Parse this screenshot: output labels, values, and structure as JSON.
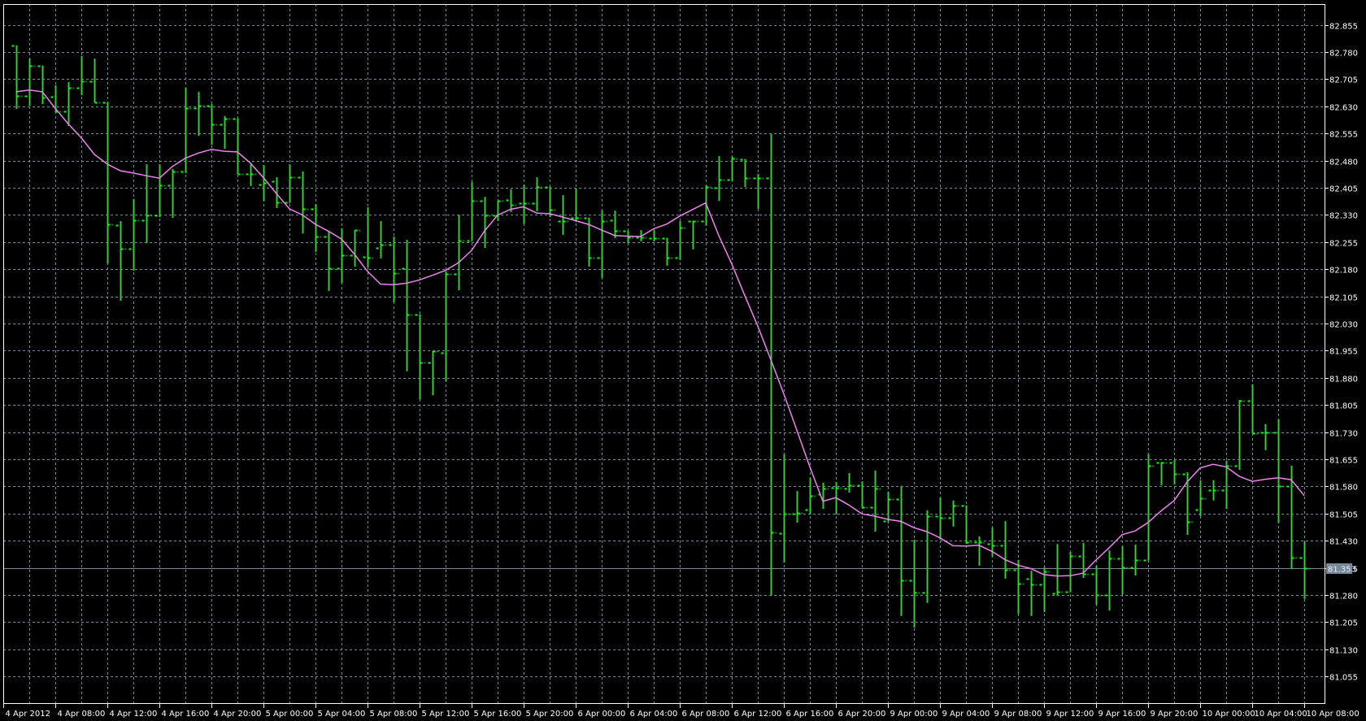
{
  "chart_data": {
    "type": "ohlc",
    "title": "",
    "colors": {
      "background": "#000000",
      "bars": "#32cd32",
      "ticks": "#00ff00",
      "ma": "#ee82ee",
      "grid": "#778899",
      "frame": "#ffffff",
      "price_line": "#778899",
      "price_label_bg": "#778899"
    },
    "ylim": [
      81.0,
      82.9
    ],
    "y_ticks": [
      "82.855",
      "82.780",
      "82.705",
      "82.630",
      "82.555",
      "82.480",
      "82.405",
      "82.330",
      "82.255",
      "82.180",
      "82.105",
      "82.030",
      "81.955",
      "81.880",
      "81.805",
      "81.730",
      "81.655",
      "81.580",
      "81.505",
      "81.430",
      "81.355",
      "81.280",
      "81.205",
      "81.130",
      "81.055"
    ],
    "x_ticks": [
      "4 Apr 2012",
      "4 Apr 08:00",
      "4 Apr 12:00",
      "4 Apr 16:00",
      "4 Apr 20:00",
      "5 Apr 00:00",
      "5 Apr 04:00",
      "5 Apr 08:00",
      "5 Apr 12:00",
      "5 Apr 16:00",
      "5 Apr 20:00",
      "6 Apr 00:00",
      "6 Apr 04:00",
      "6 Apr 08:00",
      "6 Apr 12:00",
      "6 Apr 16:00",
      "6 Apr 20:00",
      "9 Apr 00:00",
      "9 Apr 04:00",
      "9 Apr 08:00",
      "9 Apr 12:00",
      "9 Apr 16:00",
      "9 Apr 20:00",
      "10 Apr 00:00",
      "10 Apr 04:00",
      "10 Apr 08:00"
    ],
    "current_price": "81.353",
    "ma": {
      "type": "SMA",
      "period": 9,
      "centered": true
    },
    "ohlc": [
      [
        82.798,
        82.798,
        82.623,
        82.659
      ],
      [
        82.659,
        82.762,
        82.632,
        82.742
      ],
      [
        82.742,
        82.742,
        82.636,
        82.654
      ],
      [
        82.657,
        82.688,
        82.614,
        82.616
      ],
      [
        82.616,
        82.697,
        82.576,
        82.681
      ],
      [
        82.681,
        82.769,
        82.661,
        82.699
      ],
      [
        82.699,
        82.762,
        82.641,
        82.641
      ],
      [
        82.641,
        82.641,
        82.196,
        82.304
      ],
      [
        82.302,
        82.313,
        82.093,
        82.237
      ],
      [
        82.237,
        82.374,
        82.176,
        82.315
      ],
      [
        82.315,
        82.47,
        82.252,
        82.329
      ],
      [
        82.329,
        82.47,
        82.324,
        82.412
      ],
      [
        82.412,
        82.457,
        82.322,
        82.45
      ],
      [
        82.45,
        82.681,
        82.446,
        82.625
      ],
      [
        82.625,
        82.67,
        82.549,
        82.632
      ],
      [
        82.632,
        82.636,
        82.524,
        82.58
      ],
      [
        82.58,
        82.603,
        82.513,
        82.596
      ],
      [
        82.596,
        82.596,
        82.443,
        82.443
      ],
      [
        82.443,
        82.47,
        82.41,
        82.443
      ],
      [
        82.414,
        82.468,
        82.369,
        82.419
      ],
      [
        82.423,
        82.434,
        82.349,
        82.365
      ],
      [
        82.365,
        82.47,
        82.365,
        82.434
      ],
      [
        82.434,
        82.45,
        82.279,
        82.347
      ],
      [
        82.347,
        82.36,
        82.228,
        82.27
      ],
      [
        82.27,
        82.286,
        82.12,
        82.183
      ],
      [
        82.183,
        82.293,
        82.142,
        82.219
      ],
      [
        82.219,
        82.288,
        82.187,
        82.288
      ],
      [
        82.214,
        82.351,
        82.185,
        82.212
      ],
      [
        82.239,
        82.313,
        82.21,
        82.248
      ],
      [
        82.248,
        82.27,
        82.089,
        82.169
      ],
      [
        82.183,
        82.261,
        81.898,
        82.055
      ],
      [
        82.055,
        82.055,
        81.821,
        81.922
      ],
      [
        81.922,
        81.954,
        81.832,
        81.954
      ],
      [
        81.949,
        82.174,
        81.871,
        82.167
      ],
      [
        82.167,
        82.331,
        82.122,
        82.259
      ],
      [
        82.259,
        82.421,
        82.259,
        82.369
      ],
      [
        82.369,
        82.38,
        82.239,
        82.329
      ],
      [
        82.329,
        82.369,
        82.313,
        82.369
      ],
      [
        82.371,
        82.401,
        82.338,
        82.358
      ],
      [
        82.362,
        82.414,
        82.306,
        82.362
      ],
      [
        82.362,
        82.434,
        82.34,
        82.407
      ],
      [
        82.407,
        82.407,
        82.324,
        82.345
      ],
      [
        82.313,
        82.385,
        82.275,
        82.313
      ],
      [
        82.322,
        82.403,
        82.311,
        82.322
      ],
      [
        82.322,
        82.322,
        82.187,
        82.212
      ],
      [
        82.212,
        82.342,
        82.156,
        82.313
      ],
      [
        82.315,
        82.342,
        82.266,
        82.286
      ],
      [
        82.286,
        82.286,
        82.252,
        82.268
      ],
      [
        82.268,
        82.288,
        82.257,
        82.268
      ],
      [
        82.266,
        82.288,
        82.257,
        82.266
      ],
      [
        82.266,
        82.266,
        82.19,
        82.212
      ],
      [
        82.212,
        82.313,
        82.205,
        82.295
      ],
      [
        82.313,
        82.313,
        82.235,
        82.313
      ],
      [
        82.313,
        82.412,
        82.302,
        82.407
      ],
      [
        82.405,
        82.493,
        82.369,
        82.428
      ],
      [
        82.428,
        82.491,
        82.425,
        82.486
      ],
      [
        82.484,
        82.484,
        82.407,
        82.432
      ],
      [
        82.432,
        82.443,
        82.347,
        82.432
      ],
      [
        82.432,
        82.553,
        81.278,
        81.453
      ],
      [
        81.451,
        81.669,
        81.37,
        81.505
      ],
      [
        81.505,
        81.567,
        81.48,
        81.507
      ],
      [
        81.516,
        81.603,
        81.502,
        81.554
      ],
      [
        81.558,
        81.59,
        81.518,
        81.574
      ],
      [
        81.576,
        81.592,
        81.502,
        81.576
      ],
      [
        81.574,
        81.617,
        81.563,
        81.583
      ],
      [
        81.583,
        81.594,
        81.523,
        81.523
      ],
      [
        81.523,
        81.624,
        81.455,
        81.574
      ],
      [
        81.484,
        81.565,
        81.484,
        81.545
      ],
      [
        81.545,
        81.581,
        81.222,
        81.32
      ],
      [
        81.32,
        81.433,
        81.19,
        81.287
      ],
      [
        81.287,
        81.514,
        81.258,
        81.498
      ],
      [
        81.498,
        81.549,
        81.433,
        81.493
      ],
      [
        81.493,
        81.541,
        81.469,
        81.527
      ],
      [
        81.527,
        81.527,
        81.421,
        81.426
      ],
      [
        81.426,
        81.442,
        81.361,
        81.426
      ],
      [
        81.421,
        81.466,
        81.386,
        81.417
      ],
      [
        81.417,
        81.484,
        81.325,
        81.35
      ],
      [
        81.35,
        81.377,
        81.228,
        81.311
      ],
      [
        81.325,
        81.347,
        81.222,
        81.309
      ],
      [
        81.309,
        81.356,
        81.233,
        81.345
      ],
      [
        81.284,
        81.421,
        81.278,
        81.289
      ],
      [
        81.289,
        81.399,
        81.289,
        81.388
      ],
      [
        81.388,
        81.424,
        81.327,
        81.338
      ],
      [
        81.338,
        81.361,
        81.253,
        81.28
      ],
      [
        81.28,
        81.403,
        81.237,
        81.381
      ],
      [
        81.381,
        81.415,
        81.282,
        81.356
      ],
      [
        81.356,
        81.419,
        81.334,
        81.377
      ],
      [
        81.377,
        81.669,
        81.377,
        81.637
      ],
      [
        81.646,
        81.646,
        81.583,
        81.646
      ],
      [
        81.646,
        81.653,
        81.585,
        81.615
      ],
      [
        81.615,
        81.619,
        81.446,
        81.482
      ],
      [
        81.516,
        81.597,
        81.498,
        81.547
      ],
      [
        81.57,
        81.597,
        81.541,
        81.57
      ],
      [
        81.57,
        81.651,
        81.518,
        81.637
      ],
      [
        81.637,
        81.819,
        81.626,
        81.817
      ],
      [
        81.817,
        81.862,
        81.727,
        81.727
      ],
      [
        81.729,
        81.752,
        81.68,
        81.729
      ],
      [
        81.729,
        81.765,
        81.48,
        81.581
      ],
      [
        81.581,
        81.637,
        81.353,
        81.383
      ],
      [
        81.383,
        81.428,
        81.269,
        81.353
      ]
    ]
  }
}
